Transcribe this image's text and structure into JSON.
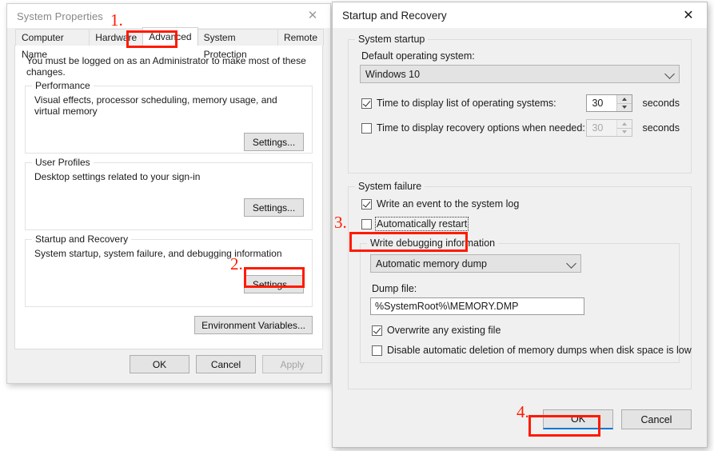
{
  "system_properties": {
    "title": "System Properties",
    "close_icon": "close-icon",
    "tabs": [
      {
        "label": "Computer Name",
        "selected": false
      },
      {
        "label": "Hardware",
        "selected": false
      },
      {
        "label": "Advanced",
        "selected": true
      },
      {
        "label": "System Protection",
        "selected": false
      },
      {
        "label": "Remote",
        "selected": false
      }
    ],
    "admin_note": "You must be logged on as an Administrator to make most of these changes.",
    "groups": [
      {
        "legend": "Performance",
        "description": "Visual effects, processor scheduling, memory usage, and virtual memory",
        "button": "Settings..."
      },
      {
        "legend": "User Profiles",
        "description": "Desktop settings related to your sign-in",
        "button": "Settings..."
      },
      {
        "legend": "Startup and Recovery",
        "description": "System startup, system failure, and debugging information",
        "button": "Settings..."
      }
    ],
    "environment_variables_button": "Environment Variables...",
    "footer": {
      "ok": "OK",
      "cancel": "Cancel",
      "apply": "Apply"
    }
  },
  "startup_recovery": {
    "title": "Startup and Recovery",
    "close_icon": "close-icon",
    "system_startup": {
      "legend": "System startup",
      "default_os_label": "Default operating system:",
      "default_os_value": "Windows 10",
      "chevron_icon": "chevron-down-icon",
      "time_list": {
        "label": "Time to display list of operating systems:",
        "accel": "T",
        "checked": true,
        "value": "30",
        "units": "seconds",
        "enabled": true
      },
      "time_recovery": {
        "label": "Time to display recovery options when needed:",
        "accel": "d",
        "checked": false,
        "value": "30",
        "units": "seconds",
        "enabled": false
      }
    },
    "system_failure": {
      "legend": "System failure",
      "write_event": {
        "label": "Write an event to the system log",
        "accel": "W",
        "checked": true
      },
      "auto_restart": {
        "label": "Automatically restart",
        "accel": "r",
        "checked": false,
        "focused": true
      },
      "debug_group": {
        "legend": "Write debugging information",
        "dump_type_value": "Automatic memory dump",
        "chevron_icon": "chevron-down-icon",
        "dump_file_label": "Dump file:",
        "dump_file_value": "%SystemRoot%\\MEMORY.DMP",
        "overwrite": {
          "label": "Overwrite any existing file",
          "accel": "O",
          "checked": true
        },
        "disable_deletion": {
          "label": "Disable automatic deletion of memory dumps when disk space is low",
          "accel": "a",
          "checked": false
        }
      }
    },
    "footer": {
      "ok": "OK",
      "cancel": "Cancel"
    }
  },
  "annotations": {
    "color": "#ff1a00",
    "steps": [
      {
        "number": "1.",
        "target": "advanced-tab"
      },
      {
        "number": "2.",
        "target": "startup-recovery-settings-button"
      },
      {
        "number": "3.",
        "target": "automatically-restart-checkbox"
      },
      {
        "number": "4.",
        "target": "startup-recovery-ok-button"
      }
    ]
  }
}
